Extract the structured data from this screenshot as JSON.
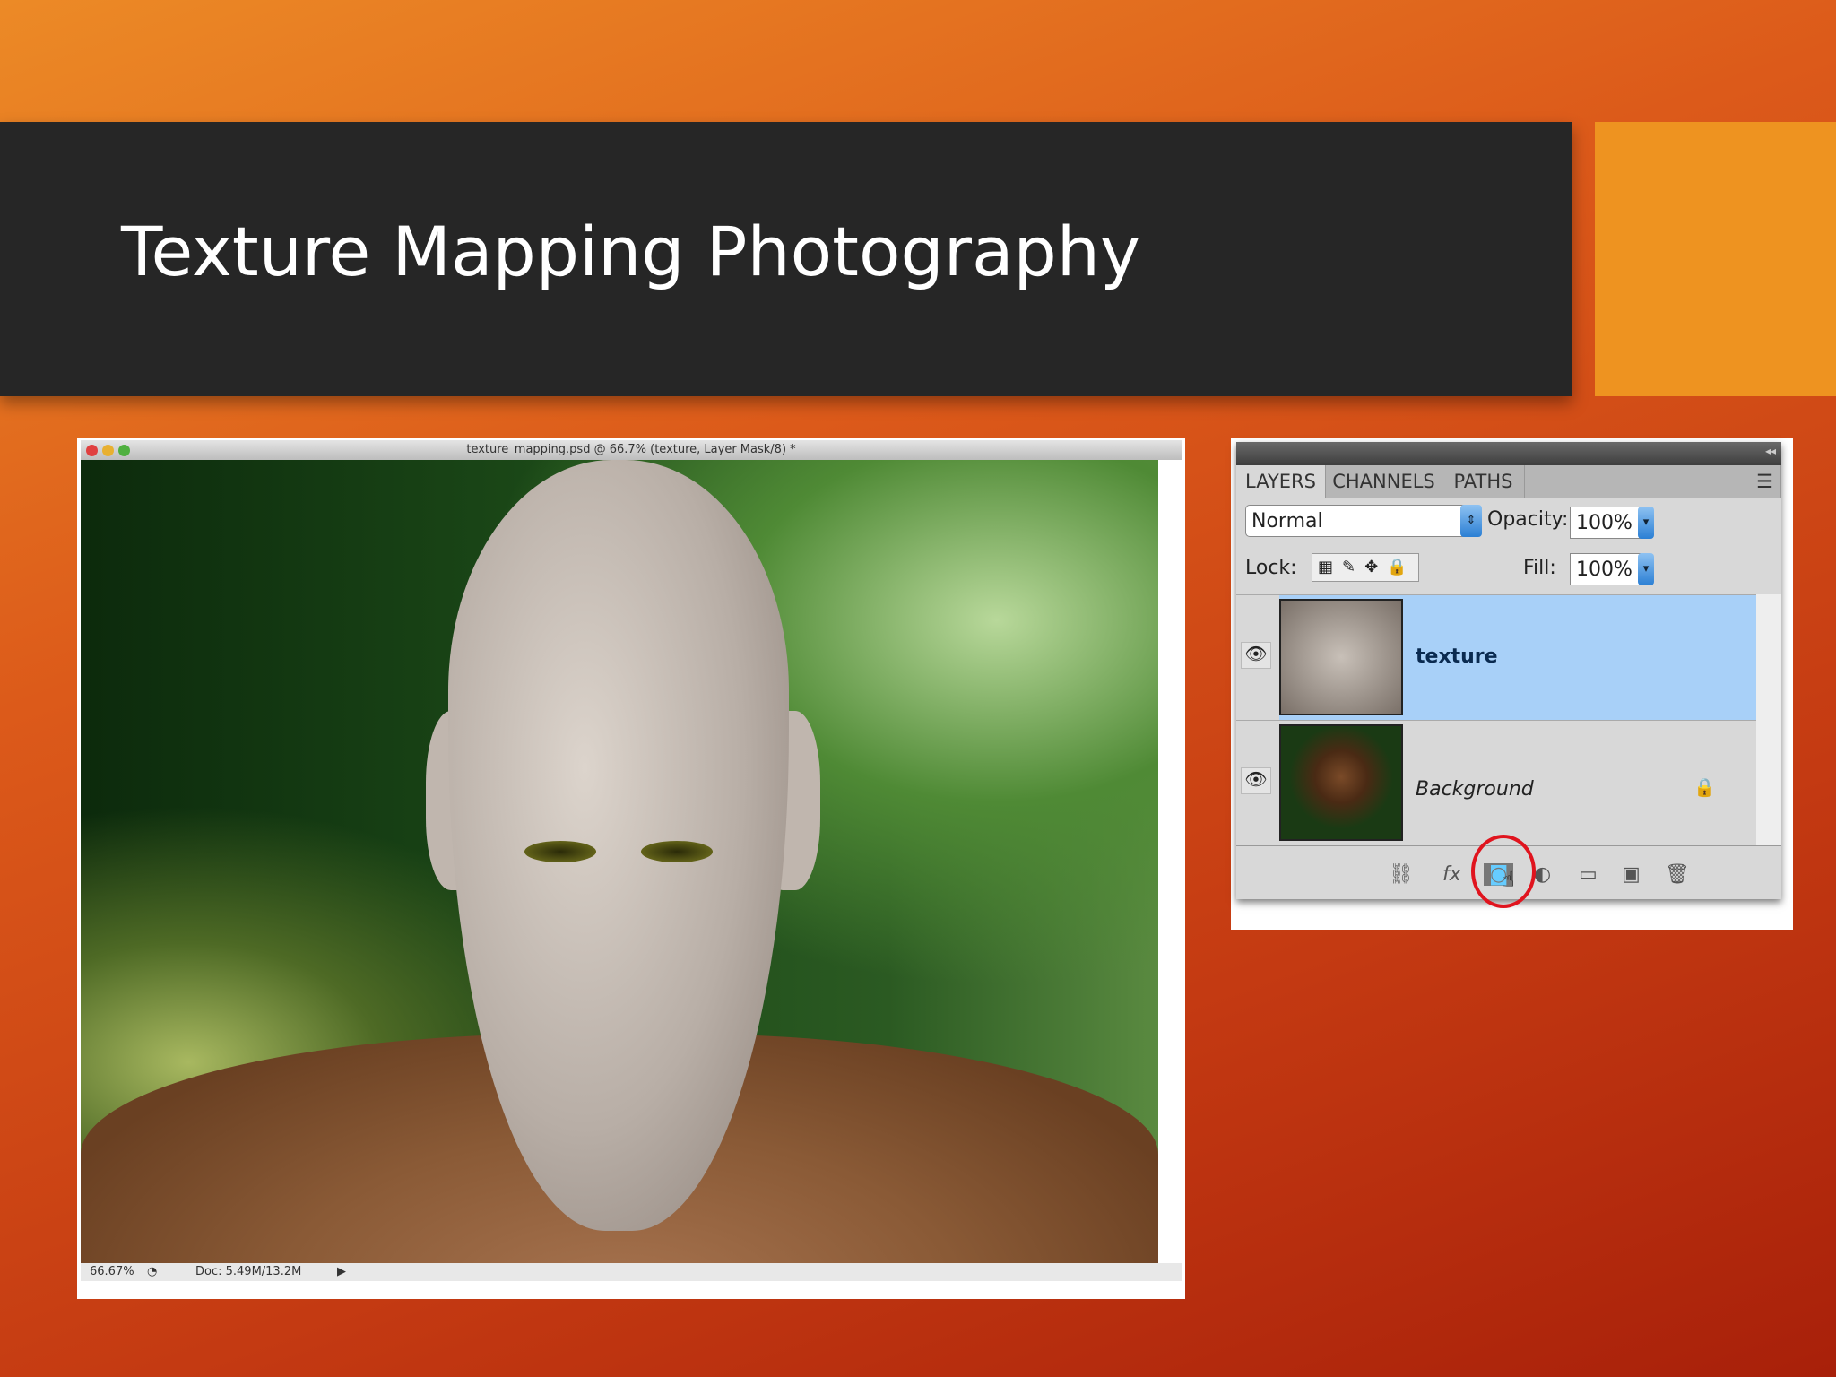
{
  "slide": {
    "title": "Texture Mapping Photography"
  },
  "ps_window": {
    "title": "texture_mapping.psd @ 66.7% (texture, Layer Mask/8) *",
    "zoom": "66.67%",
    "doc": "Doc: 5.49M/13.2M"
  },
  "layers_panel": {
    "tabs": [
      "LAYERS",
      "CHANNELS",
      "PATHS"
    ],
    "blend_mode": "Normal",
    "opacity_label": "Opacity:",
    "opacity": "100%",
    "lock_label": "Lock:",
    "fill_label": "Fill:",
    "fill": "100%",
    "layers": [
      {
        "name": "texture",
        "selected": true
      },
      {
        "name": "Background",
        "locked": true
      }
    ]
  },
  "colors": {
    "selected_layer": "#a8d0f8",
    "highlight_circle": "#e0141e"
  }
}
